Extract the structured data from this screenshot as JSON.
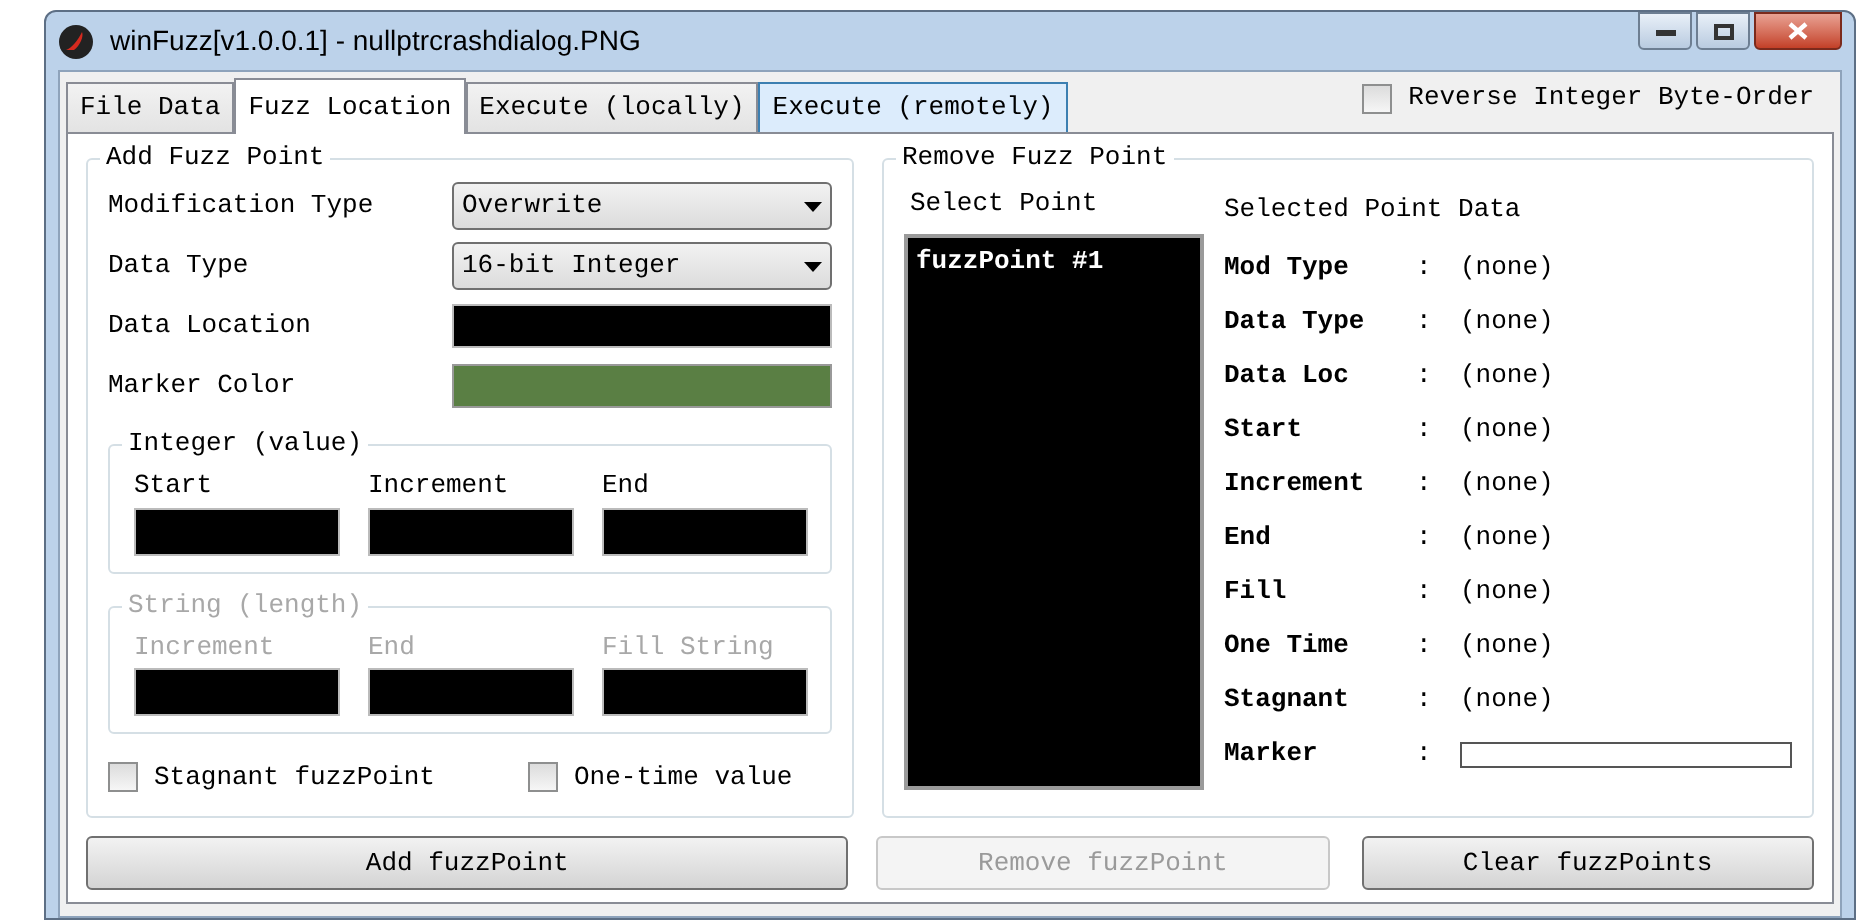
{
  "window": {
    "title": "winFuzz[v1.0.0.1] - nullptrcrashdialog.PNG"
  },
  "tabs": [
    {
      "label": "File Data",
      "selected": false,
      "hovered": false
    },
    {
      "label": "Fuzz Location",
      "selected": true,
      "hovered": false
    },
    {
      "label": "Execute (locally)",
      "selected": false,
      "hovered": false
    },
    {
      "label": "Execute (remotely)",
      "selected": false,
      "hovered": true
    }
  ],
  "reverse_byte_order": {
    "label": "Reverse Integer Byte-Order",
    "checked": false
  },
  "add_panel": {
    "title": "Add Fuzz Point",
    "fields": [
      {
        "label": "Modification Type",
        "kind": "dropdown",
        "value": "Overwrite"
      },
      {
        "label": "Data Type",
        "kind": "dropdown",
        "value": "16-bit Integer"
      },
      {
        "label": "Data Location",
        "kind": "input"
      },
      {
        "label": "Marker Color",
        "kind": "color",
        "color": "#5a7f44"
      }
    ],
    "groups": [
      {
        "title": "Integer (value)",
        "disabled": false,
        "fields": [
          "Start",
          "Increment",
          "End"
        ]
      },
      {
        "title": "String (length)",
        "disabled": true,
        "fields": [
          "Increment",
          "End",
          "Fill String"
        ]
      }
    ],
    "checkboxes": [
      {
        "label": "Stagnant fuzzPoint",
        "checked": false
      },
      {
        "label": "One-time value",
        "checked": false
      }
    ]
  },
  "remove_panel": {
    "title": "Remove Fuzz Point",
    "select_label": "Select Point",
    "points": [
      {
        "label": "fuzzPoint #1",
        "selected": false
      }
    ],
    "data_title": "Selected Point Data",
    "rows": [
      {
        "label": "Mod Type",
        "kind": "text",
        "value": "(none)"
      },
      {
        "label": "Data Type",
        "kind": "text",
        "value": "(none)"
      },
      {
        "label": "Data Loc",
        "kind": "text",
        "value": "(none)"
      },
      {
        "label": "Start",
        "kind": "text",
        "value": "(none)"
      },
      {
        "label": "Increment",
        "kind": "text",
        "value": "(none)"
      },
      {
        "label": "End",
        "kind": "text",
        "value": "(none)"
      },
      {
        "label": "Fill",
        "kind": "text",
        "value": "(none)"
      },
      {
        "label": "One Time",
        "kind": "text",
        "value": "(none)"
      },
      {
        "label": "Stagnant",
        "kind": "text",
        "value": "(none)"
      },
      {
        "label": "Marker",
        "kind": "swatch",
        "color": "#ffffff"
      }
    ],
    "separator": ":"
  },
  "buttons": [
    {
      "label": "Add fuzzPoint",
      "disabled": false
    },
    {
      "label": "Remove fuzzPoint",
      "disabled": true
    },
    {
      "label": "Clear fuzzPoints",
      "disabled": false
    }
  ]
}
